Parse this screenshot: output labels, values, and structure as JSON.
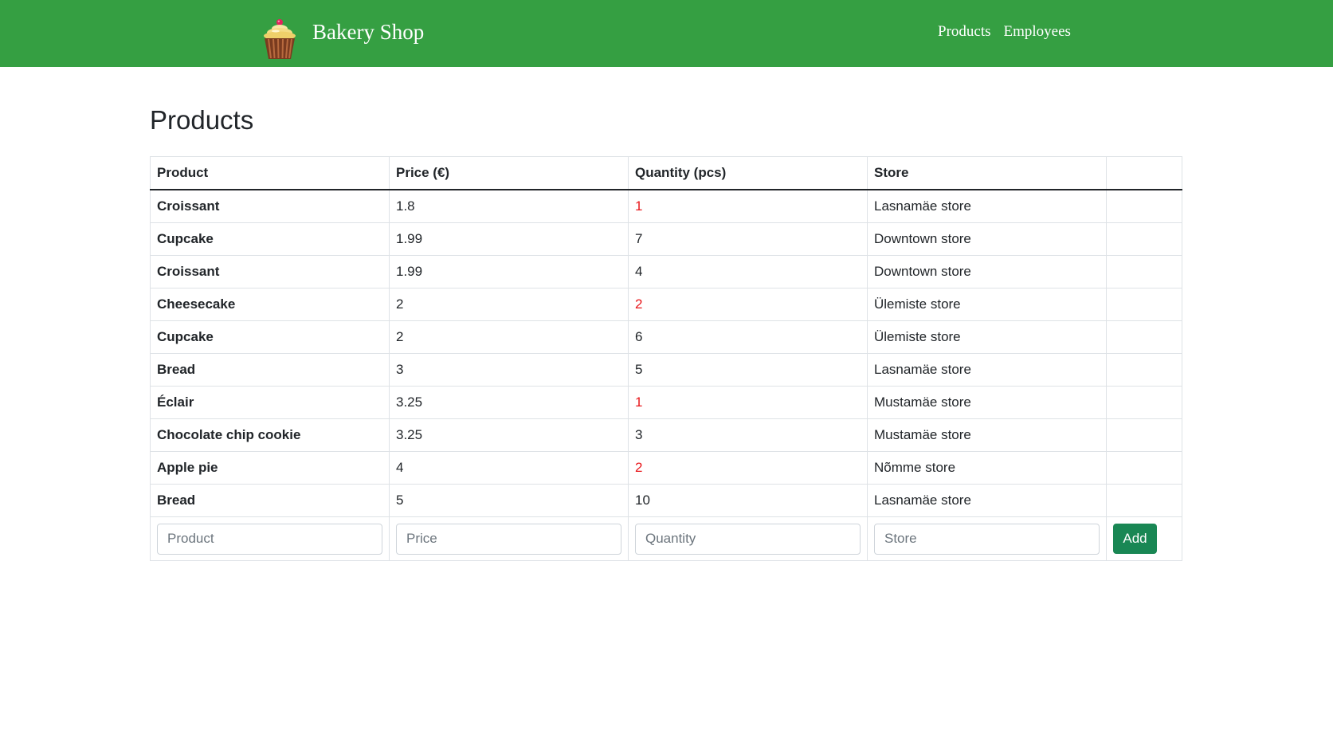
{
  "navbar": {
    "brand": "Bakery Shop",
    "links": [
      "Products",
      "Employees"
    ],
    "logo_icon": "cupcake-icon",
    "background": "#359f42"
  },
  "page": {
    "title": "Products"
  },
  "table": {
    "headers": [
      "Product",
      "Price (€)",
      "Quantity (pcs)",
      "Store",
      ""
    ],
    "rows": [
      {
        "product": "Croissant",
        "price": "1.8",
        "quantity": "1",
        "store": "Lasnamäe store",
        "low_stock": true
      },
      {
        "product": "Cupcake",
        "price": "1.99",
        "quantity": "7",
        "store": "Downtown store",
        "low_stock": false
      },
      {
        "product": "Croissant",
        "price": "1.99",
        "quantity": "4",
        "store": "Downtown store",
        "low_stock": false
      },
      {
        "product": "Cheesecake",
        "price": "2",
        "quantity": "2",
        "store": "Ülemiste store",
        "low_stock": true
      },
      {
        "product": "Cupcake",
        "price": "2",
        "quantity": "6",
        "store": "Ülemiste store",
        "low_stock": false
      },
      {
        "product": "Bread",
        "price": "3",
        "quantity": "5",
        "store": "Lasnamäe store",
        "low_stock": false
      },
      {
        "product": "Éclair",
        "price": "3.25",
        "quantity": "1",
        "store": "Mustamäe store",
        "low_stock": true
      },
      {
        "product": "Chocolate chip cookie",
        "price": "3.25",
        "quantity": "3",
        "store": "Mustamäe store",
        "low_stock": false
      },
      {
        "product": "Apple pie",
        "price": "4",
        "quantity": "2",
        "store": "Nõmme store",
        "low_stock": true
      },
      {
        "product": "Bread",
        "price": "5",
        "quantity": "10",
        "store": "Lasnamäe store",
        "low_stock": false
      }
    ],
    "low_stock_color": "#e8161a"
  },
  "form": {
    "product_placeholder": "Product",
    "price_placeholder": "Price",
    "quantity_placeholder": "Quantity",
    "store_placeholder": "Store",
    "add_label": "Add",
    "button_color": "#198754"
  }
}
